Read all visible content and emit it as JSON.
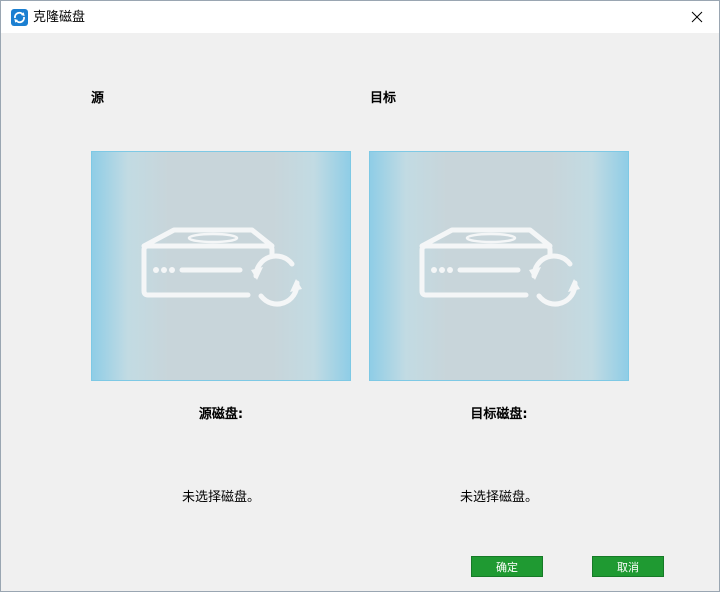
{
  "window": {
    "title": "克隆磁盘",
    "app_icon": "clone-disk-app-icon",
    "close_icon": "close-icon"
  },
  "source": {
    "label": "源",
    "disk_title": "源磁盘:",
    "status": "未选择磁盘。",
    "icon": "disk-clone-icon"
  },
  "target": {
    "label": "目标",
    "disk_title": "目标磁盘:",
    "status": "未选择磁盘。",
    "icon": "disk-clone-icon"
  },
  "buttons": {
    "ok_label": "确定",
    "cancel_label": "取消"
  },
  "colors": {
    "button_green": "#1f9a32",
    "panel_border": "#7ec9e5"
  }
}
